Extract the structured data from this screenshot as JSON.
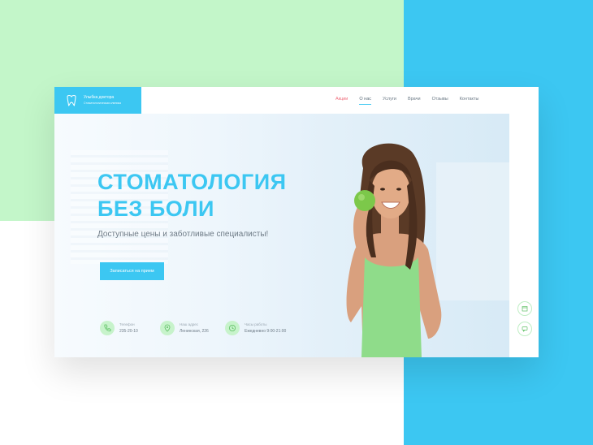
{
  "brand": {
    "title": "Улыбка доктора",
    "subtitle": "Стоматологическая клиника"
  },
  "nav": {
    "items": [
      "Акции",
      "О нас",
      "Услуги",
      "Врачи",
      "Отзывы",
      "Контакты"
    ],
    "active": "О нас"
  },
  "hero": {
    "headline_line1": "СТОМАТОЛОГИЯ",
    "headline_line2": "БЕЗ БОЛИ",
    "subtitle": "Доступные цены и заботливые специалисты!",
    "cta_label": "Записаться на прием"
  },
  "contacts": [
    {
      "label": "Телефон",
      "value": "235-20-10",
      "icon": "phone-icon"
    },
    {
      "label": "Наш адрес",
      "value": "Ленинская, 226",
      "icon": "location-pin-icon"
    },
    {
      "label": "Часы работы",
      "value": "Ежедневно 9:00-21:00",
      "icon": "clock-icon"
    }
  ],
  "colors": {
    "accent": "#3cc7f2",
    "green_bg": "#c3f6c9",
    "promo": "#ef6b7a"
  }
}
